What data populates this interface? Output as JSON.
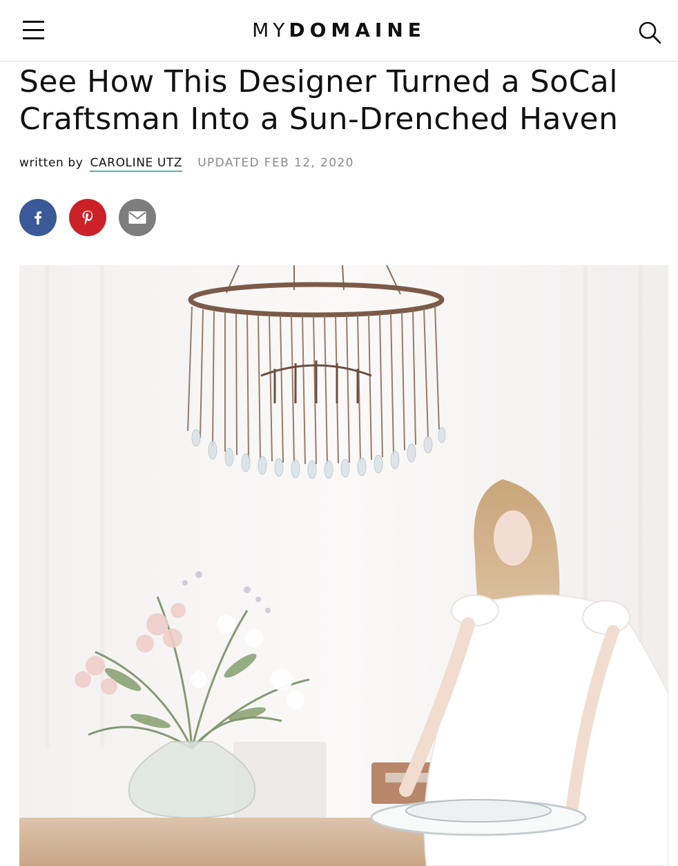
{
  "header": {
    "logo_light": "MY",
    "logo_bold": "DOMAINE"
  },
  "article": {
    "title": "See How This Designer Turned a SoCal Craftsman Into a Sun-Drenched Haven",
    "byline_prefix": "written by",
    "author": "CAROLINE UTZ",
    "updated": "UPDATED FEB 12, 2020"
  },
  "share": {
    "items": [
      {
        "network": "facebook",
        "icon": "facebook-icon",
        "color": "#3b5998"
      },
      {
        "network": "pinterest",
        "icon": "pinterest-icon",
        "color": "#cc2127"
      },
      {
        "network": "email",
        "icon": "mail-icon",
        "color": "#7d7d7d"
      }
    ]
  },
  "hero_image": {
    "subject": "woman setting plates on a wooden table beneath a crystal chandelier with a flower vase"
  },
  "colors": {
    "author_underline": "#4eb7a9",
    "text": "#111111",
    "meta_text": "#8a8a8a"
  }
}
